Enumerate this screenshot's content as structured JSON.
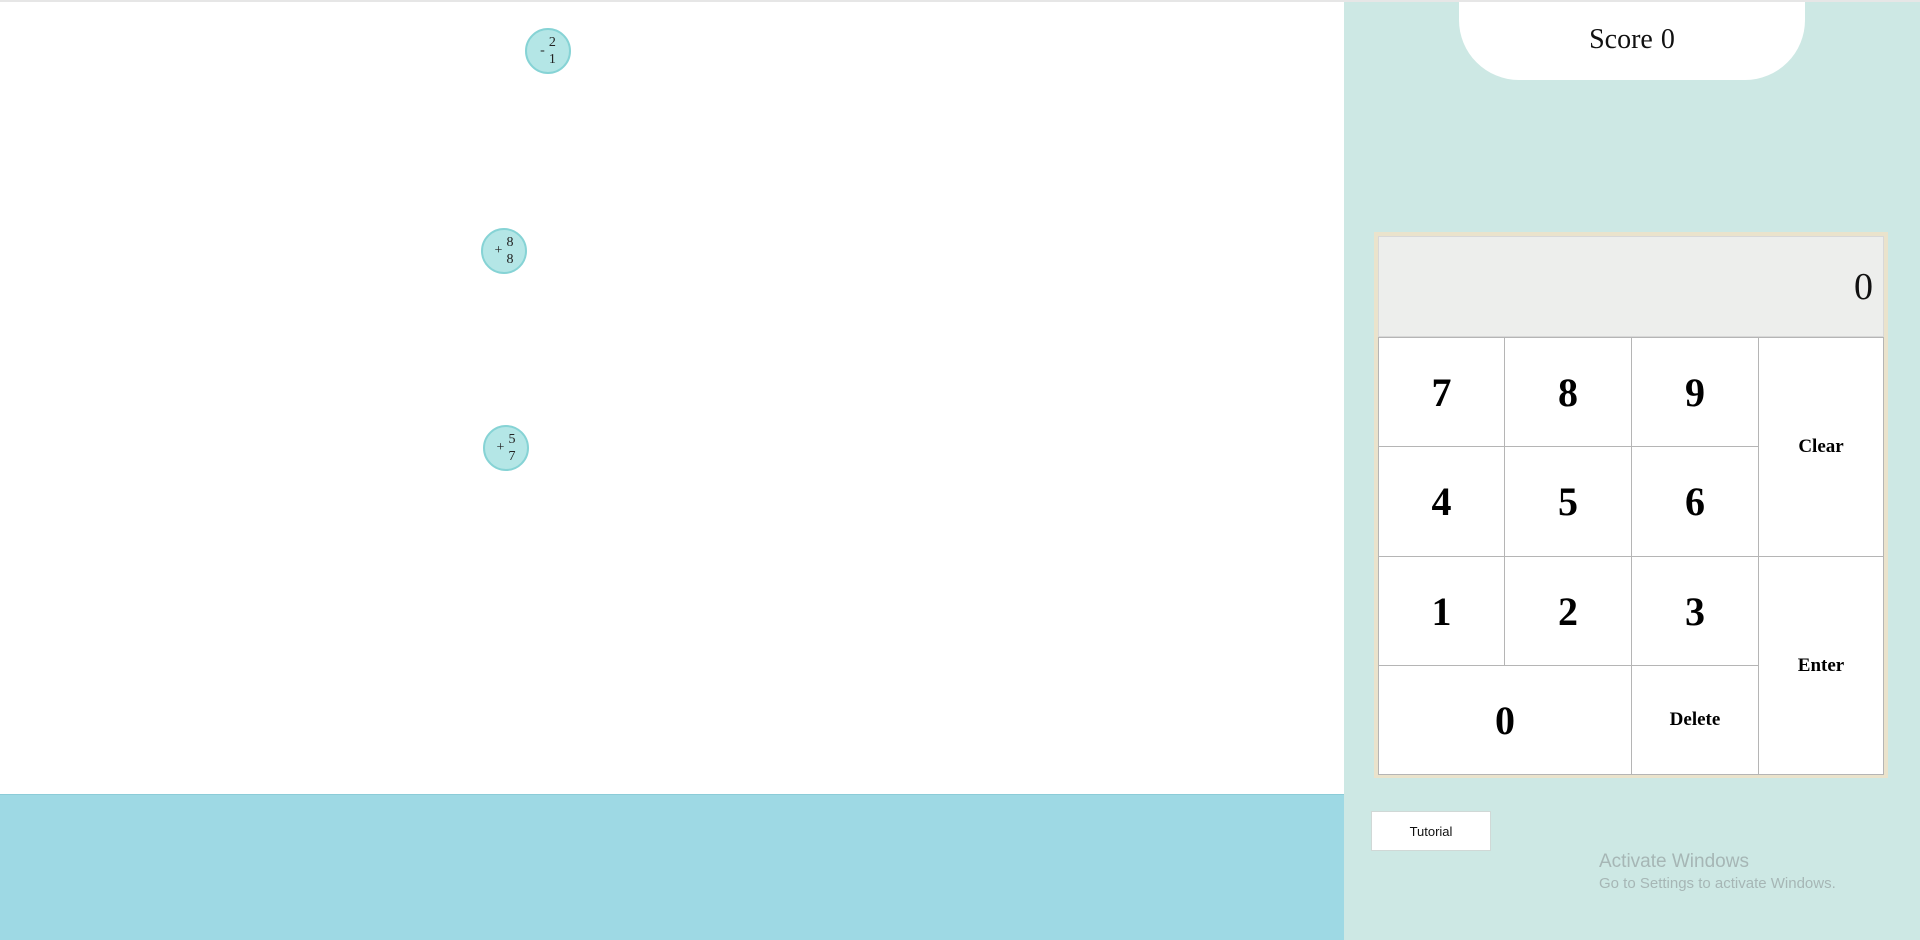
{
  "score": {
    "label": "Score",
    "value": "0"
  },
  "bubbles": [
    {
      "sign": "-",
      "top": "2",
      "bottom": "1"
    },
    {
      "sign": "+",
      "top": "8",
      "bottom": "8"
    },
    {
      "sign": "+",
      "top": "5",
      "bottom": "7"
    }
  ],
  "calculator": {
    "display": "0",
    "keys": {
      "k7": "7",
      "k8": "8",
      "k9": "9",
      "k4": "4",
      "k5": "5",
      "k6": "6",
      "k1": "1",
      "k2": "2",
      "k3": "3",
      "k0": "0",
      "clear": "Clear",
      "enter": "Enter",
      "delete": "Delete"
    }
  },
  "tutorial_label": "Tutorial",
  "watermark": {
    "title": "Activate Windows",
    "subtitle": "Go to Settings to activate Windows."
  },
  "colors": {
    "bubble_fill": "#b4e6e6",
    "ground": "#9ed9e4",
    "panel": "#cde8e4",
    "calculator_frame": "#eae3cc"
  }
}
